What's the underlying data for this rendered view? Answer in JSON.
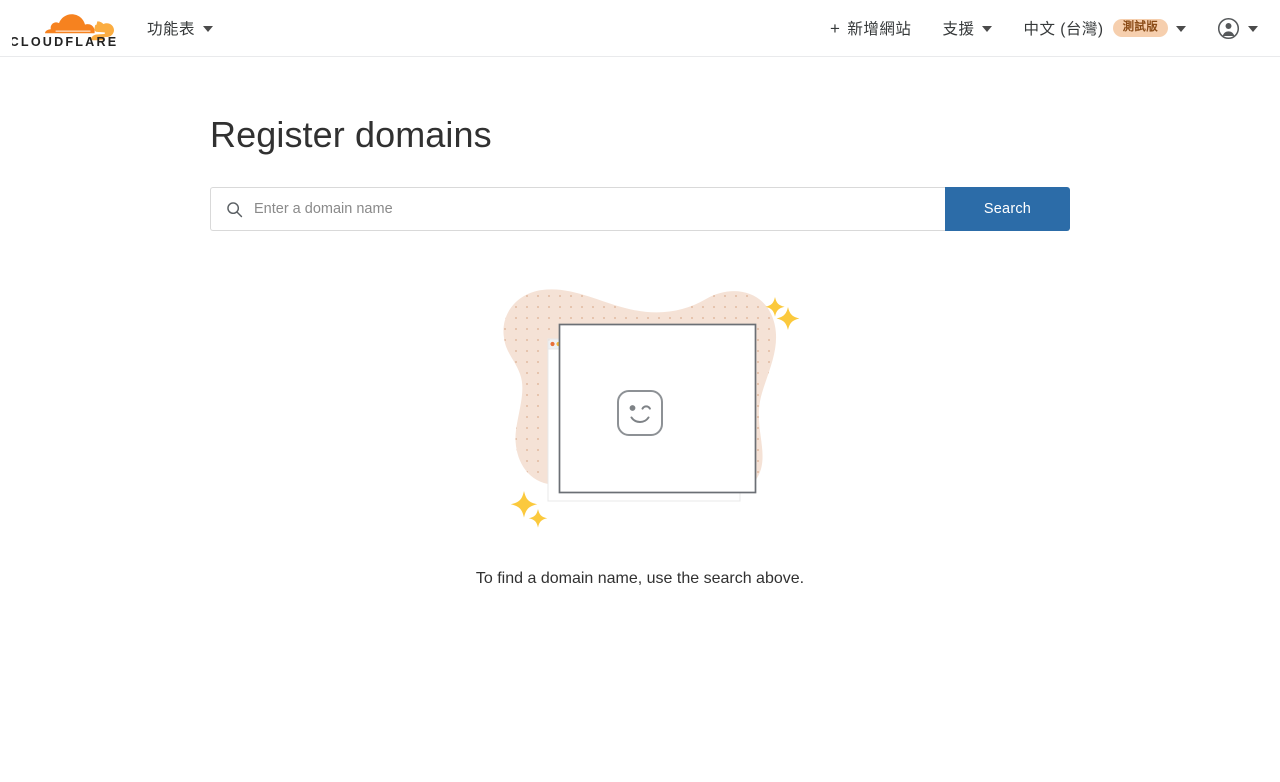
{
  "header": {
    "logo": {
      "icon": "cloudflare-logo",
      "wordmark": "CLOUDFLARE"
    },
    "left_nav": [
      {
        "label": "功能表",
        "icon": "chevron-down-icon",
        "name": "menu"
      }
    ],
    "right_nav": {
      "add_site": {
        "label": "新增網站",
        "icon": "plus-icon"
      },
      "support": {
        "label": "支援",
        "icon": "chevron-down-icon"
      },
      "language": {
        "label": "中文 (台灣)",
        "badge": "測試版",
        "icon": "chevron-down-icon"
      },
      "account": {
        "icon": "account-circle-icon",
        "caret": "chevron-down-icon"
      }
    }
  },
  "main": {
    "title": "Register domains",
    "search": {
      "placeholder": "Enter a domain name",
      "value": "",
      "icon": "search-icon",
      "button_label": "Search"
    },
    "empty_state": {
      "illustration": "empty-browser-window-illustration",
      "face_icon": "winking-face-icon",
      "message": "To find a domain name, use the search above."
    }
  },
  "colors": {
    "accent_blue": "#2c6ca8",
    "brand_orange": "#f6821f",
    "brand_orange_light": "#fbad41",
    "badge_bg": "#f6cfae",
    "badge_text": "#8a4b16",
    "blob_beige": "#f5e2d6",
    "sparkle_yellow": "#fbc93d",
    "window_border_dark": "#6b6f75",
    "window_border_light": "#e8e8e8",
    "text_primary": "#313131",
    "placeholder_gray": "#8a8a8a"
  }
}
